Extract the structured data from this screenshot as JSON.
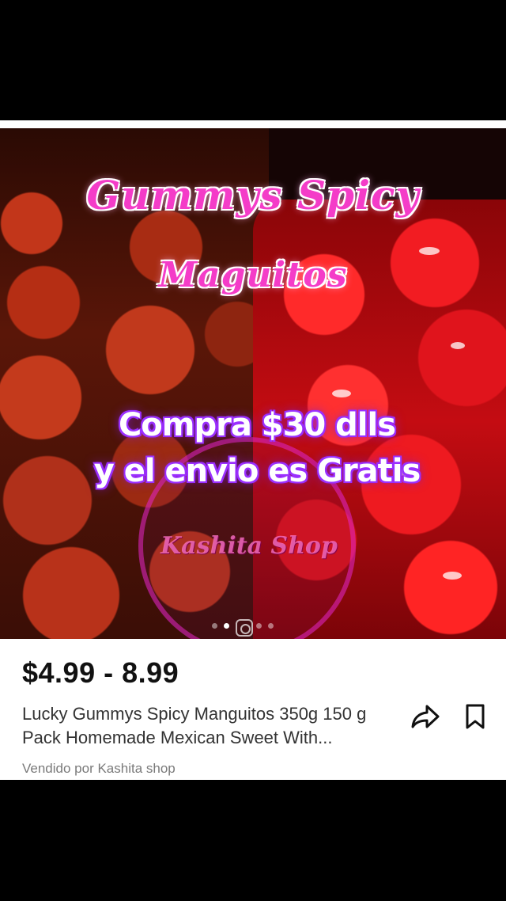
{
  "hero": {
    "title_line1": "Gummys Spicy",
    "title_line2": "Maguitos",
    "promo_line1": "Compra $30 dlls",
    "promo_line2": "y el envio es Gratis",
    "watermark": "Kashita Shop",
    "carousel_dots": 4,
    "active_dot": 1
  },
  "product": {
    "price": "$4.99 - 8.99",
    "title": "Lucky Gummys Spicy Manguitos 350g 150 g Pack Homemade Mexican Sweet With...",
    "seller": "Vendido por Kashita shop",
    "share_icon": "share-icon",
    "bookmark_icon": "bookmark-icon"
  }
}
